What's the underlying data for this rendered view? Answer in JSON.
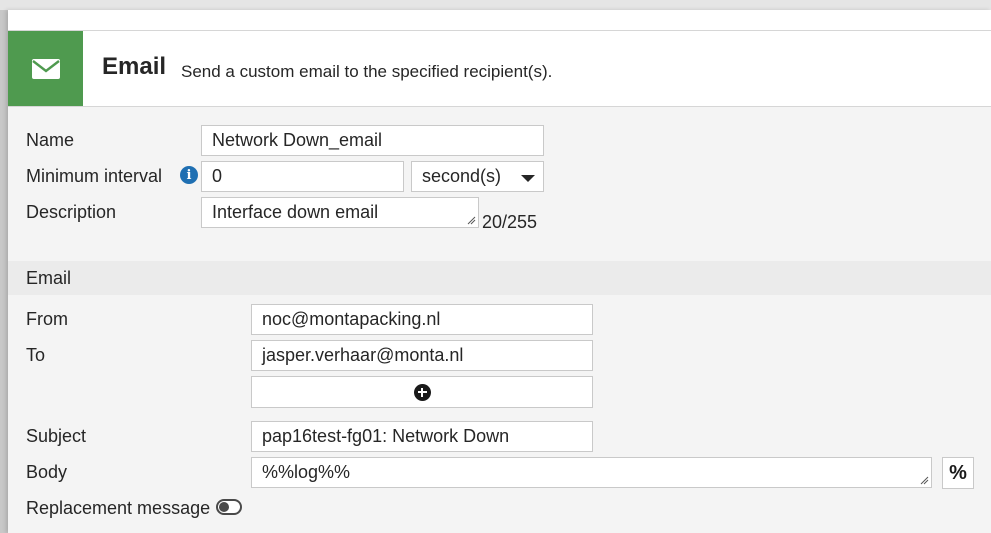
{
  "header": {
    "title": "Email",
    "description": "Send a custom email to the specified recipient(s).",
    "icon": "envelope-icon",
    "icon_bg_color": "#4f9a4f"
  },
  "form": {
    "name_label": "Name",
    "name_value": "Network Down_email",
    "min_interval_label": "Minimum interval",
    "min_interval_info_icon": "info-icon",
    "min_interval_value": "0",
    "min_interval_unit": "second(s)",
    "description_label": "Description",
    "description_value": "Interface down email",
    "description_counter": "20/255"
  },
  "email_section": {
    "title": "Email",
    "from_label": "From",
    "from_value": "noc@montapacking.nl",
    "to_label": "To",
    "to_value": "jasper.verhaar@monta.nl",
    "add_recipient_icon": "plus-circle-icon",
    "subject_label": "Subject",
    "subject_value": "pap16test-fg01: Network Down",
    "body_label": "Body",
    "body_value": "%%log%%",
    "insert_variable_label": "%",
    "replacement_message_label": "Replacement message",
    "replacement_message_enabled": false
  }
}
